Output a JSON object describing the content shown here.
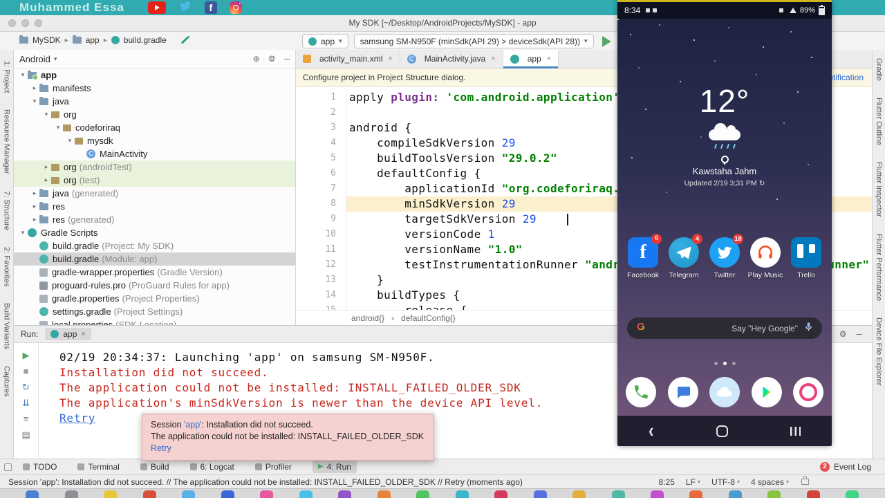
{
  "banner": {
    "title": "Muhammed Essa",
    "icons": [
      "youtube-icon",
      "twitter-icon",
      "facebook-icon",
      "instagram-icon"
    ],
    "bg_color": "#31aab1"
  },
  "title_bar": {
    "title": "My SDK [~/Desktop/AndroidProjects/MySDK] - app"
  },
  "toolbar": {
    "breadcrumb": [
      "MySDK",
      "app",
      "build.gradle"
    ],
    "run_config": "app",
    "device": "samsung SM-N950F (minSdk(API 29) > deviceSdk(API 28))"
  },
  "left_strip": [
    {
      "label": "1: Project"
    },
    {
      "label": "Resource Manager"
    },
    {
      "label": "7: Structure"
    },
    {
      "label": "2: Favorites"
    },
    {
      "label": "Build Variants"
    },
    {
      "label": "Captures"
    }
  ],
  "right_strip": [
    {
      "label": "Gradle"
    },
    {
      "label": "Flutter Outline"
    },
    {
      "label": "Flutter Inspector"
    },
    {
      "label": "Flutter Performance"
    },
    {
      "label": "Device File Explorer"
    }
  ],
  "project": {
    "header": "Android",
    "items": [
      {
        "label": "app",
        "indent": 0,
        "icon": "app-folder",
        "expand": "open",
        "bold": true
      },
      {
        "label": "manifests",
        "indent": 1,
        "icon": "folder",
        "expand": "closed"
      },
      {
        "label": "java",
        "indent": 1,
        "icon": "folder",
        "expand": "open"
      },
      {
        "label": "org",
        "indent": 2,
        "icon": "package",
        "expand": "open"
      },
      {
        "label": "codeforiraq",
        "indent": 3,
        "icon": "package",
        "expand": "open"
      },
      {
        "label": "mysdk",
        "indent": 4,
        "icon": "package",
        "expand": "open"
      },
      {
        "label": "MainActivity",
        "indent": 5,
        "icon": "class",
        "expand": "none"
      },
      {
        "label": "org",
        "hint": "(androidTest)",
        "indent": 2,
        "icon": "package",
        "expand": "closed",
        "row": "green"
      },
      {
        "label": "org",
        "hint": "(test)",
        "indent": 2,
        "icon": "package",
        "expand": "closed",
        "row": "green"
      },
      {
        "label": "java",
        "hint": "(generated)",
        "indent": 1,
        "icon": "folder",
        "expand": "closed"
      },
      {
        "label": "res",
        "indent": 1,
        "icon": "folder",
        "expand": "closed"
      },
      {
        "label": "res",
        "hint": "(generated)",
        "indent": 1,
        "icon": "folder",
        "expand": "closed"
      },
      {
        "label": "Gradle Scripts",
        "indent": 0,
        "icon": "gradle",
        "expand": "open"
      },
      {
        "label": "build.gradle",
        "hint": "(Project: My SDK)",
        "indent": 1,
        "icon": "gradle-file",
        "expand": "none"
      },
      {
        "label": "build.gradle",
        "hint": "(Module: app)",
        "indent": 1,
        "icon": "gradle-file",
        "expand": "none",
        "row": "selected"
      },
      {
        "label": "gradle-wrapper.properties",
        "hint": "(Gradle Version)",
        "indent": 1,
        "icon": "props",
        "expand": "none"
      },
      {
        "label": "proguard-rules.pro",
        "hint": "(ProGuard Rules for app)",
        "indent": 1,
        "icon": "pro",
        "expand": "none"
      },
      {
        "label": "gradle.properties",
        "hint": "(Project Properties)",
        "indent": 1,
        "icon": "props",
        "expand": "none"
      },
      {
        "label": "settings.gradle",
        "hint": "(Project Settings)",
        "indent": 1,
        "icon": "gradle-file",
        "expand": "none"
      },
      {
        "label": "local.properties",
        "hint": "(SDK Location)",
        "indent": 1,
        "icon": "props",
        "expand": "none"
      }
    ]
  },
  "editor": {
    "tabs": [
      {
        "label": "activity_main.xml",
        "icon": "xml",
        "active": false
      },
      {
        "label": "MainActivity.java",
        "icon": "class",
        "active": false
      },
      {
        "label": "app",
        "icon": "gradle",
        "active": true
      }
    ],
    "notification": {
      "text": "Configure project in Project Structure dialog.",
      "action": "Hide notification"
    },
    "breadcrumb": [
      "android{}",
      "defaultConfig{}"
    ],
    "code": {
      "lines": [
        {
          "n": 1,
          "tokens": [
            [
              "apply ",
              "p"
            ],
            [
              "plugin: ",
              "k"
            ],
            [
              "'com.android.application'",
              "s"
            ]
          ]
        },
        {
          "n": 2,
          "tokens": []
        },
        {
          "n": 3,
          "tokens": [
            [
              "android {",
              "p"
            ]
          ]
        },
        {
          "n": 4,
          "tokens": [
            [
              "    compileSdkVersion ",
              "p"
            ],
            [
              "29",
              "n"
            ]
          ]
        },
        {
          "n": 5,
          "tokens": [
            [
              "    buildToolsVersion ",
              "p"
            ],
            [
              "\"29.0.2\"",
              "s"
            ]
          ]
        },
        {
          "n": 6,
          "tokens": [
            [
              "    defaultConfig {",
              "p"
            ]
          ]
        },
        {
          "n": 7,
          "tokens": [
            [
              "        applicationId ",
              "p"
            ],
            [
              "\"org.codeforiraq.mysdk\"",
              "s"
            ]
          ]
        },
        {
          "n": 8,
          "tokens": [
            [
              "        minSdkVersion ",
              "p"
            ],
            [
              "29",
              "n"
            ]
          ],
          "highlight": true
        },
        {
          "n": 9,
          "tokens": [
            [
              "        targetSdkVersion ",
              "p"
            ],
            [
              "29",
              "n"
            ]
          ],
          "caret": true
        },
        {
          "n": 10,
          "tokens": [
            [
              "        versionCode ",
              "p"
            ],
            [
              "1",
              "n"
            ]
          ]
        },
        {
          "n": 11,
          "tokens": [
            [
              "        versionName ",
              "p"
            ],
            [
              "\"1.0\"",
              "s"
            ]
          ]
        },
        {
          "n": 12,
          "tokens": [
            [
              "        testInstrumentationRunner ",
              "p"
            ],
            [
              "\"androidx.test.runner.AndroidJUnitRunner\"",
              "s"
            ]
          ]
        },
        {
          "n": 13,
          "tokens": [
            [
              "    }",
              "p"
            ]
          ]
        },
        {
          "n": 14,
          "tokens": [
            [
              "    buildTypes {",
              "p"
            ]
          ]
        },
        {
          "n": 15,
          "tokens": [
            [
              "        release {",
              "p"
            ]
          ]
        }
      ]
    }
  },
  "run_panel": {
    "label": "Run:",
    "tab": "app",
    "gutter_icons": [
      {
        "name": "rerun-icon",
        "glyph": "▶",
        "color": "#59a869"
      },
      {
        "name": "stop-icon",
        "glyph": "■",
        "color": "#9aa0a6"
      },
      {
        "name": "restart-icon",
        "glyph": "↻",
        "color": "#4a7fbe"
      },
      {
        "name": "scroll-to-end-icon",
        "glyph": "⇊",
        "color": "#4a7fbe"
      },
      {
        "name": "soft-wrap-icon",
        "glyph": "≡",
        "color": "#777777"
      },
      {
        "name": "clear-all-icon",
        "glyph": "▤",
        "color": "#777777"
      }
    ],
    "console": [
      {
        "text": "02/19 20:34:37: Launching 'app' on samsung SM-N950F.",
        "style": "plain"
      },
      {
        "text": "Installation did not succeed.",
        "style": "error"
      },
      {
        "text": "The application could not be installed: INSTALL_FAILED_OLDER_SDK",
        "style": "error"
      },
      {
        "text": "The application's minSdkVersion is newer than the device API level.",
        "style": "error"
      },
      {
        "text": "Retry",
        "style": "link"
      }
    ]
  },
  "tooltip": {
    "lines": [
      [
        [
          "Session ",
          "t"
        ],
        [
          "'app'",
          "link"
        ],
        [
          ": Installation did not succeed.",
          "t"
        ]
      ],
      [
        [
          "The application could not be installed: INSTALL_FAILED_OLDER_SDK",
          "t"
        ]
      ],
      [
        [
          "Retry",
          "link"
        ]
      ]
    ]
  },
  "bottom_bar": {
    "tabs": [
      {
        "label": "TODO",
        "active": false
      },
      {
        "label": "Terminal",
        "active": false
      },
      {
        "label": "Build",
        "active": false
      },
      {
        "label": "6: Logcat",
        "active": false
      },
      {
        "label": "Profiler",
        "active": false
      },
      {
        "label": "4: Run",
        "active": true
      }
    ],
    "event_log": {
      "label": "Event Log",
      "badge": "2"
    }
  },
  "status_bar": {
    "message": "Session 'app': Installation did not succeed. // The application could not be installed: INSTALL_FAILED_OLDER_SDK // Retry (moments ago)",
    "caret": "8:25",
    "items": [
      "LF",
      "UTF-8",
      "4 spaces"
    ]
  },
  "phone": {
    "status": {
      "time": "8:34",
      "battery": "89%"
    },
    "weather": {
      "temp": "12°",
      "location": "Kawstaha Jahm",
      "updated": "Updated 2/19 3:31 PM"
    },
    "apps": [
      {
        "label": "Facebook",
        "badge": "6",
        "icon": "facebook-app-icon"
      },
      {
        "label": "Telegram",
        "badge": "4",
        "icon": "telegram-app-icon"
      },
      {
        "label": "Twitter",
        "badge": "18",
        "icon": "twitter-app-icon"
      },
      {
        "label": "Play Music",
        "badge": "",
        "icon": "play-music-app-icon"
      },
      {
        "label": "Trello",
        "badge": "",
        "icon": "trello-app-icon"
      }
    ],
    "search_hint": "Say \"Hey Google\"",
    "dock": [
      "phone-app-icon",
      "messages-app-icon",
      "gallery-app-icon",
      "play-store-app-icon",
      "camera-app-icon"
    ],
    "nav": [
      "back",
      "home",
      "recents"
    ]
  },
  "dock_strip": {
    "icon_colors": [
      "#4a7fd4",
      "#8e8e93",
      "#e8c63a",
      "#d94f3a",
      "#58b0e8",
      "#3a66d9",
      "#e85aa0",
      "#47c1e8",
      "#9254c8",
      "#e8833a",
      "#4fc562",
      "#3ab5c9",
      "#d43a5e",
      "#5870e0",
      "#e0b03a",
      "#50b8a8",
      "#c44fd0",
      "#e86a3a",
      "#4a9ad4",
      "#88c440",
      "#d4443a",
      "#43d487"
    ]
  }
}
